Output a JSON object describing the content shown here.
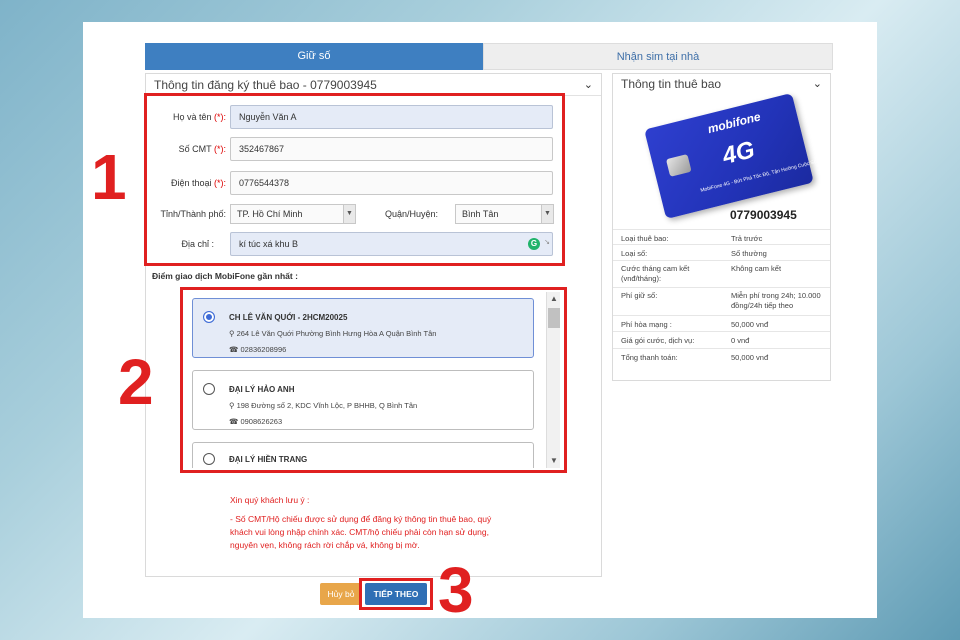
{
  "tabs": {
    "reserve": "Giữ số",
    "receive": "Nhận sim tại nhà"
  },
  "left_panel": {
    "title": "Thông tin đăng ký thuê bao - 0779003945"
  },
  "form": {
    "name_label": "Họ và tên",
    "name_value": "Nguyễn Văn A",
    "id_label": "Số CMT",
    "id_value": "352467867",
    "phone_label": "Điện thoại",
    "phone_value": "0776544378",
    "required_mark": "(*):",
    "city_label": "Tỉnh/Thành phố:",
    "city_value": "TP. Hồ Chí Minh",
    "district_label": "Quận/Huyện:",
    "district_value": "Bình Tân",
    "address_label": "Địa chỉ :",
    "address_value": "kí túc xá khu B"
  },
  "stores_title": "Điểm giao dịch MobiFone gần nhất :",
  "stores": [
    {
      "name": "CH LÊ VĂN QUỚI - 2HCM20025",
      "address": "264 Lê Văn Quới Phường Bình Hưng Hòa A Quận Bình Tân",
      "phone": "02836208996",
      "selected": true
    },
    {
      "name": "ĐẠI LÝ HẢO ANH",
      "address": "198 Đường số 2, KDC Vĩnh Lộc, P BHHB, Q Bình Tân",
      "phone": "0908626263",
      "selected": false
    },
    {
      "name": "ĐẠI LÝ HIỀN TRANG",
      "address": "",
      "phone": "",
      "selected": false
    }
  ],
  "notice": {
    "title": "Xin quý khách lưu ý :",
    "line1": "- Số CMT/Hộ chiếu được sử dụng để đăng ký thông tin thuê bao, quý",
    "line2": "khách vui lòng nhập chính xác. CMT/hộ chiếu phải còn hạn sử dụng,",
    "line3": "nguyên vẹn, không rách rời chắp vá, không bị mờ."
  },
  "buttons": {
    "cancel": "Hủy bỏ",
    "next": "TIẾP THEO"
  },
  "right_panel": {
    "title": "Thông tin thuê bao"
  },
  "sim": {
    "brand": "mobifone",
    "tech": "4G",
    "tagline": "MobiFone 4G - Bứt Phá Tốc Độ, Tận Hưởng Cuộc Sống",
    "number": "0779003945"
  },
  "subscriber_info": [
    {
      "key": "Loại thuê bao:",
      "value": "Trả trước"
    },
    {
      "key": "Loại số:",
      "value": "Số thường"
    },
    {
      "key": "Cước tháng cam kết (vnđ/tháng):",
      "value": "Không cam kết"
    },
    {
      "key": "Phí giữ số:",
      "value": "Miễn phí trong 24h; 10.000 đồng/24h tiếp theo"
    },
    {
      "key": "Phí hòa mạng :",
      "value": "50,000 vnđ"
    },
    {
      "key": "Giá gói cước, dịch vụ:",
      "value": "0 vnđ"
    },
    {
      "key": "Tổng thanh toán:",
      "value": "50,000 vnđ"
    }
  ],
  "annotations": {
    "step1": "1",
    "step2": "2",
    "step3": "3"
  }
}
